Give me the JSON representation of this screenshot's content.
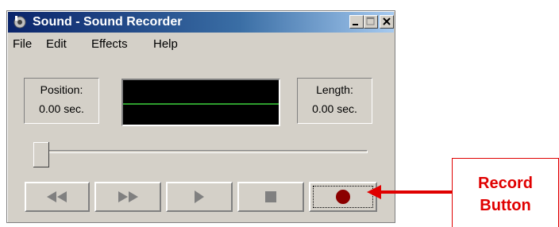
{
  "window": {
    "title": "Sound - Sound Recorder",
    "buttons": [
      "minimize-icon",
      "maximize-icon",
      "close-icon"
    ]
  },
  "menu": {
    "file": "File",
    "edit": "Edit",
    "effects": "Effects",
    "help": "Help"
  },
  "position": {
    "label": "Position:",
    "value": "0.00 sec."
  },
  "length": {
    "label": "Length:",
    "value": "0.00 sec."
  },
  "waveform": {
    "background": "#000000",
    "line_color": "#2e9e2e"
  },
  "seek": {
    "level": 0
  },
  "controls": [
    "rewind-icon",
    "fast-forward-icon",
    "play-icon",
    "stop-icon",
    "record-icon"
  ],
  "colors": {
    "record": "#8b0000",
    "annotation": "#e00000"
  },
  "annotation": {
    "line1": "Record",
    "line2": "Button"
  }
}
